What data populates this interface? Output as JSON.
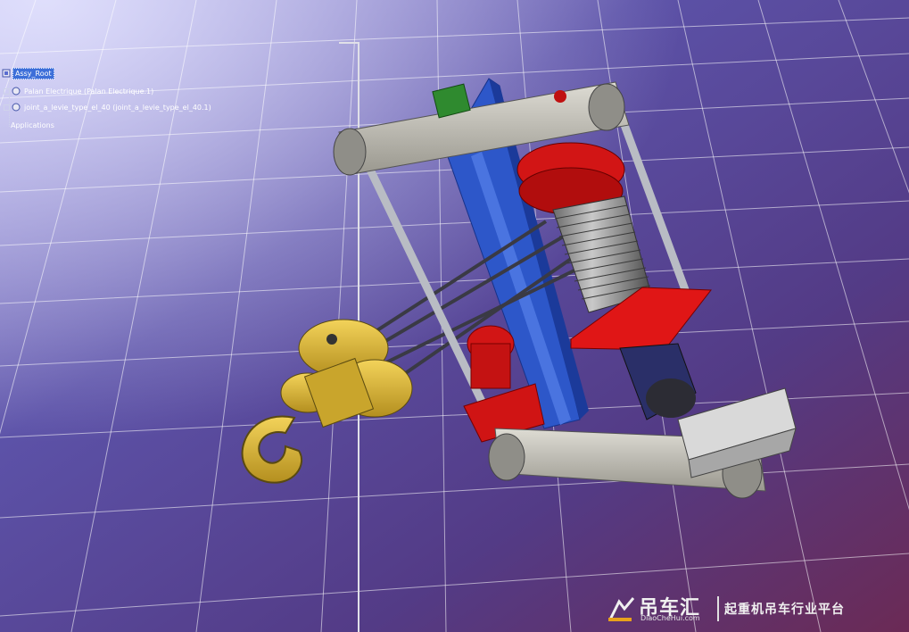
{
  "tree": {
    "root_label": "Assy_Root",
    "nodes": [
      {
        "label": "Palan Electrique (Palan Electrique.1)"
      },
      {
        "label": "joint_a_levie_type_el_40 (joint_a_levie_type_el_40.1)"
      },
      {
        "label": "Applications"
      }
    ]
  },
  "watermark": {
    "brand_cn": "吊车汇",
    "brand_en": "DiaoCheHui.com",
    "slogan": "起重机吊车行业平台"
  },
  "colors": {
    "background_top": "#8a86d2",
    "background_bottom": "#6a2a55",
    "frame_blue": "#2d57c9",
    "motor_red": "#d21515",
    "hook_yellow": "#d9b636",
    "beam_gray": "#c8c6be"
  }
}
